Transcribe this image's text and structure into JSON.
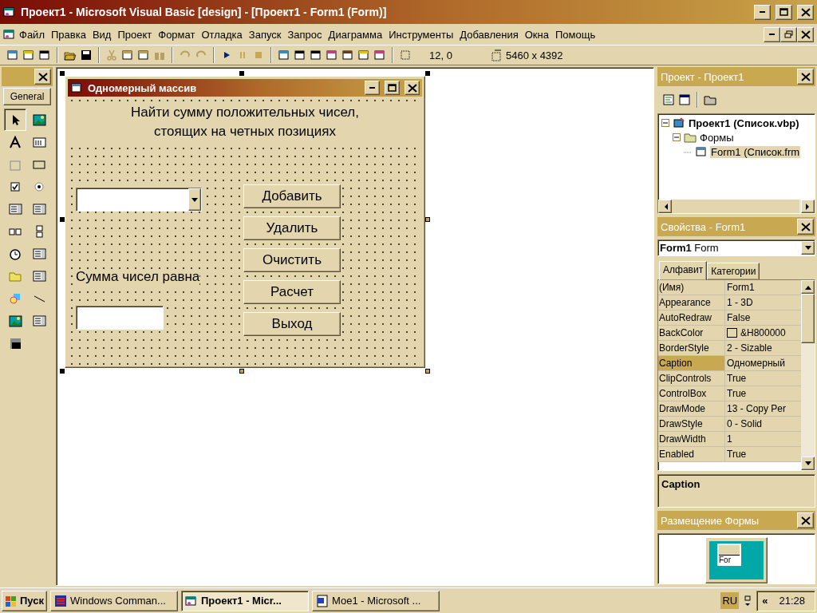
{
  "window": {
    "title": "Проект1 - Microsoft Visual Basic [design] - [Проект1 - Form1 (Form)]",
    "menu": [
      "Файл",
      "Правка",
      "Вид",
      "Проект",
      "Формат",
      "Отладка",
      "Запуск",
      "Запрос",
      "Диаграмма",
      "Инструменты",
      "Добавления",
      "Окна",
      "Помощь"
    ]
  },
  "toolbar": {
    "position": "12, 0",
    "size": "5460 x 4392"
  },
  "toolbox": {
    "tab": "General"
  },
  "form": {
    "title": "Одномерный массив",
    "heading": [
      "Найти сумму положительных чисел,",
      "стоящих на четных позициях"
    ],
    "sum_label": "Сумма чисел равна",
    "buttons": [
      "Добавить",
      "Удалить",
      "Очистить",
      "Расчет",
      "Выход"
    ]
  },
  "project": {
    "title": "Проект - Проект1",
    "tree": [
      {
        "label": "Проект1 (Список.vbp)",
        "expanded": true,
        "selected": false,
        "children": [
          {
            "label": "Формы",
            "expanded": true,
            "selected": false,
            "children": [
              {
                "label": "Form1 (Список.frm",
                "selected": true
              }
            ]
          }
        ]
      }
    ]
  },
  "properties": {
    "title": "Свойства - Form1",
    "object_name": "Form1",
    "object_type": "Form",
    "tabs": [
      {
        "label": "Алфавит",
        "selected": true
      },
      {
        "label": "Категории",
        "selected": false
      }
    ],
    "rows": [
      {
        "name": "(Имя)",
        "value": "Form1",
        "selected": false
      },
      {
        "name": "Appearance",
        "value": "1 - 3D",
        "selected": false
      },
      {
        "name": "AutoRedraw",
        "value": "False",
        "selected": false
      },
      {
        "name": "BackColor",
        "value": "&H800000",
        "selected": false,
        "color": "#e3d6ae"
      },
      {
        "name": "BorderStyle",
        "value": "2 - Sizable",
        "selected": false
      },
      {
        "name": "Caption",
        "value": "Одномерный",
        "selected": true
      },
      {
        "name": "ClipControls",
        "value": "True",
        "selected": false
      },
      {
        "name": "ControlBox",
        "value": "True",
        "selected": false
      },
      {
        "name": "DrawMode",
        "value": "13 - Copy Per",
        "selected": false
      },
      {
        "name": "DrawStyle",
        "value": "0 - Solid",
        "selected": false
      },
      {
        "name": "DrawWidth",
        "value": "1",
        "selected": false
      },
      {
        "name": "Enabled",
        "value": "True",
        "selected": false
      }
    ],
    "description": "Caption"
  },
  "form_layout": {
    "title": "Размещение Формы",
    "thumb_label": "For"
  },
  "taskbar": {
    "start": "Пуск",
    "tasks": [
      {
        "label": "Windows Comman...",
        "selected": false
      },
      {
        "label": "Проект1 - Micr...",
        "selected": true
      },
      {
        "label": "Мое1 - Microsoft ...",
        "selected": false
      }
    ],
    "language": "RU",
    "tray_toggle": "«",
    "clock": "21:28"
  }
}
